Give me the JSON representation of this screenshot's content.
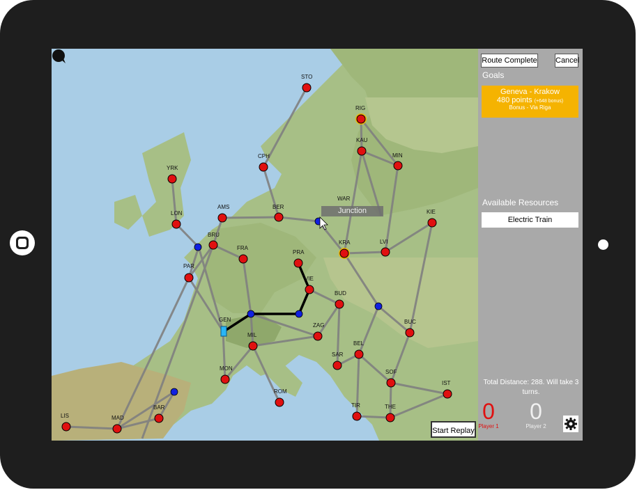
{
  "top_buttons": {
    "route_complete": "Route Complete",
    "cancel": "Cancel"
  },
  "goals": {
    "title": "Goals",
    "card": {
      "route": "Geneva - Krakow",
      "points": "480 points",
      "bonus_points": "(+648 bonus)",
      "bonus": "Bonus - Via Riga"
    }
  },
  "resources": {
    "title": "Available Resources",
    "items": [
      "Electric Train"
    ]
  },
  "distance_text": "Total Distance: 288. Will take 3 turns.",
  "players": [
    {
      "name": "Player 1",
      "score": "0",
      "color": "#e01010"
    },
    {
      "name": "Player 2",
      "score": "0",
      "color": "#f0f0f0"
    }
  ],
  "map": {
    "junction_label": "Junction",
    "start_replay": "Start Replay",
    "cities": [
      {
        "code": "STO"
      },
      {
        "code": "RIG"
      },
      {
        "code": "KAU"
      },
      {
        "code": "MIN"
      },
      {
        "code": "CPH"
      },
      {
        "code": "YRK"
      },
      {
        "code": "LON"
      },
      {
        "code": "AMS"
      },
      {
        "code": "BER"
      },
      {
        "code": "WAR"
      },
      {
        "code": "KIE"
      },
      {
        "code": "BRU"
      },
      {
        "code": "FRA"
      },
      {
        "code": "PRA"
      },
      {
        "code": "KRA"
      },
      {
        "code": "LVI"
      },
      {
        "code": "PAR"
      },
      {
        "code": "VIE"
      },
      {
        "code": "BUD"
      },
      {
        "code": "GEN"
      },
      {
        "code": "ZAG"
      },
      {
        "code": "MIL"
      },
      {
        "code": "BEL"
      },
      {
        "code": "BUC"
      },
      {
        "code": "SAR"
      },
      {
        "code": "MON"
      },
      {
        "code": "SOF"
      },
      {
        "code": "IST"
      },
      {
        "code": "ROM"
      },
      {
        "code": "BAR"
      },
      {
        "code": "MAD"
      },
      {
        "code": "LIS"
      },
      {
        "code": "TIR"
      },
      {
        "code": "THE"
      }
    ]
  },
  "colors": {
    "city_node": "#e01010",
    "junction_node": "#1020e0",
    "rail": "#808080",
    "route": "#000000",
    "goal_card": "#f5b301",
    "side_panel": "#a9a9a9",
    "highlight_ring": "#f5b301"
  }
}
